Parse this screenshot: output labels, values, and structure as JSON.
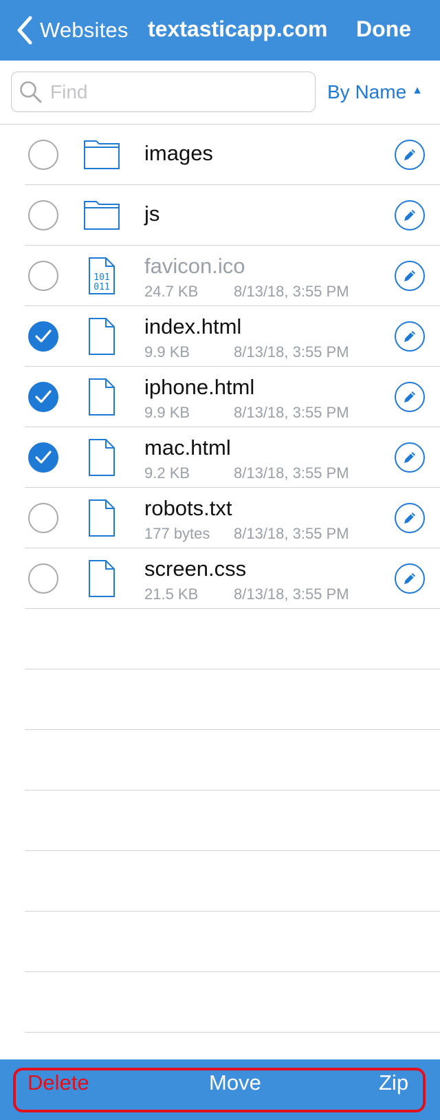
{
  "nav": {
    "back_label": "Websites",
    "title": "textasticapp.com",
    "done_label": "Done"
  },
  "search": {
    "placeholder": "Find",
    "value": ""
  },
  "sort": {
    "label": "By Name",
    "arrow": "▲"
  },
  "files": [
    {
      "name": "images",
      "kind": "folder",
      "size": "",
      "date": "",
      "selected": false,
      "dimmed": false
    },
    {
      "name": "js",
      "kind": "folder",
      "size": "",
      "date": "",
      "selected": false,
      "dimmed": false
    },
    {
      "name": "favicon.ico",
      "kind": "binary",
      "size": "24.7 KB",
      "date": "8/13/18, 3:55 PM",
      "selected": false,
      "dimmed": true
    },
    {
      "name": "index.html",
      "kind": "file",
      "size": "9.9 KB",
      "date": "8/13/18, 3:55 PM",
      "selected": true,
      "dimmed": false
    },
    {
      "name": "iphone.html",
      "kind": "file",
      "size": "9.9 KB",
      "date": "8/13/18, 3:55 PM",
      "selected": true,
      "dimmed": false
    },
    {
      "name": "mac.html",
      "kind": "file",
      "size": "9.2 KB",
      "date": "8/13/18, 3:55 PM",
      "selected": true,
      "dimmed": false
    },
    {
      "name": "robots.txt",
      "kind": "file",
      "size": "177 bytes",
      "date": "8/13/18, 3:55 PM",
      "selected": false,
      "dimmed": false
    },
    {
      "name": "screen.css",
      "kind": "file",
      "size": "21.5 KB",
      "date": "8/13/18, 3:55 PM",
      "selected": false,
      "dimmed": false
    }
  ],
  "toolbar": {
    "delete_label": "Delete",
    "move_label": "Move",
    "zip_label": "Zip"
  },
  "colors": {
    "nav_bar": "#3d8fdb",
    "accent": "#1f7ad6",
    "destructive": "#e0101e"
  }
}
